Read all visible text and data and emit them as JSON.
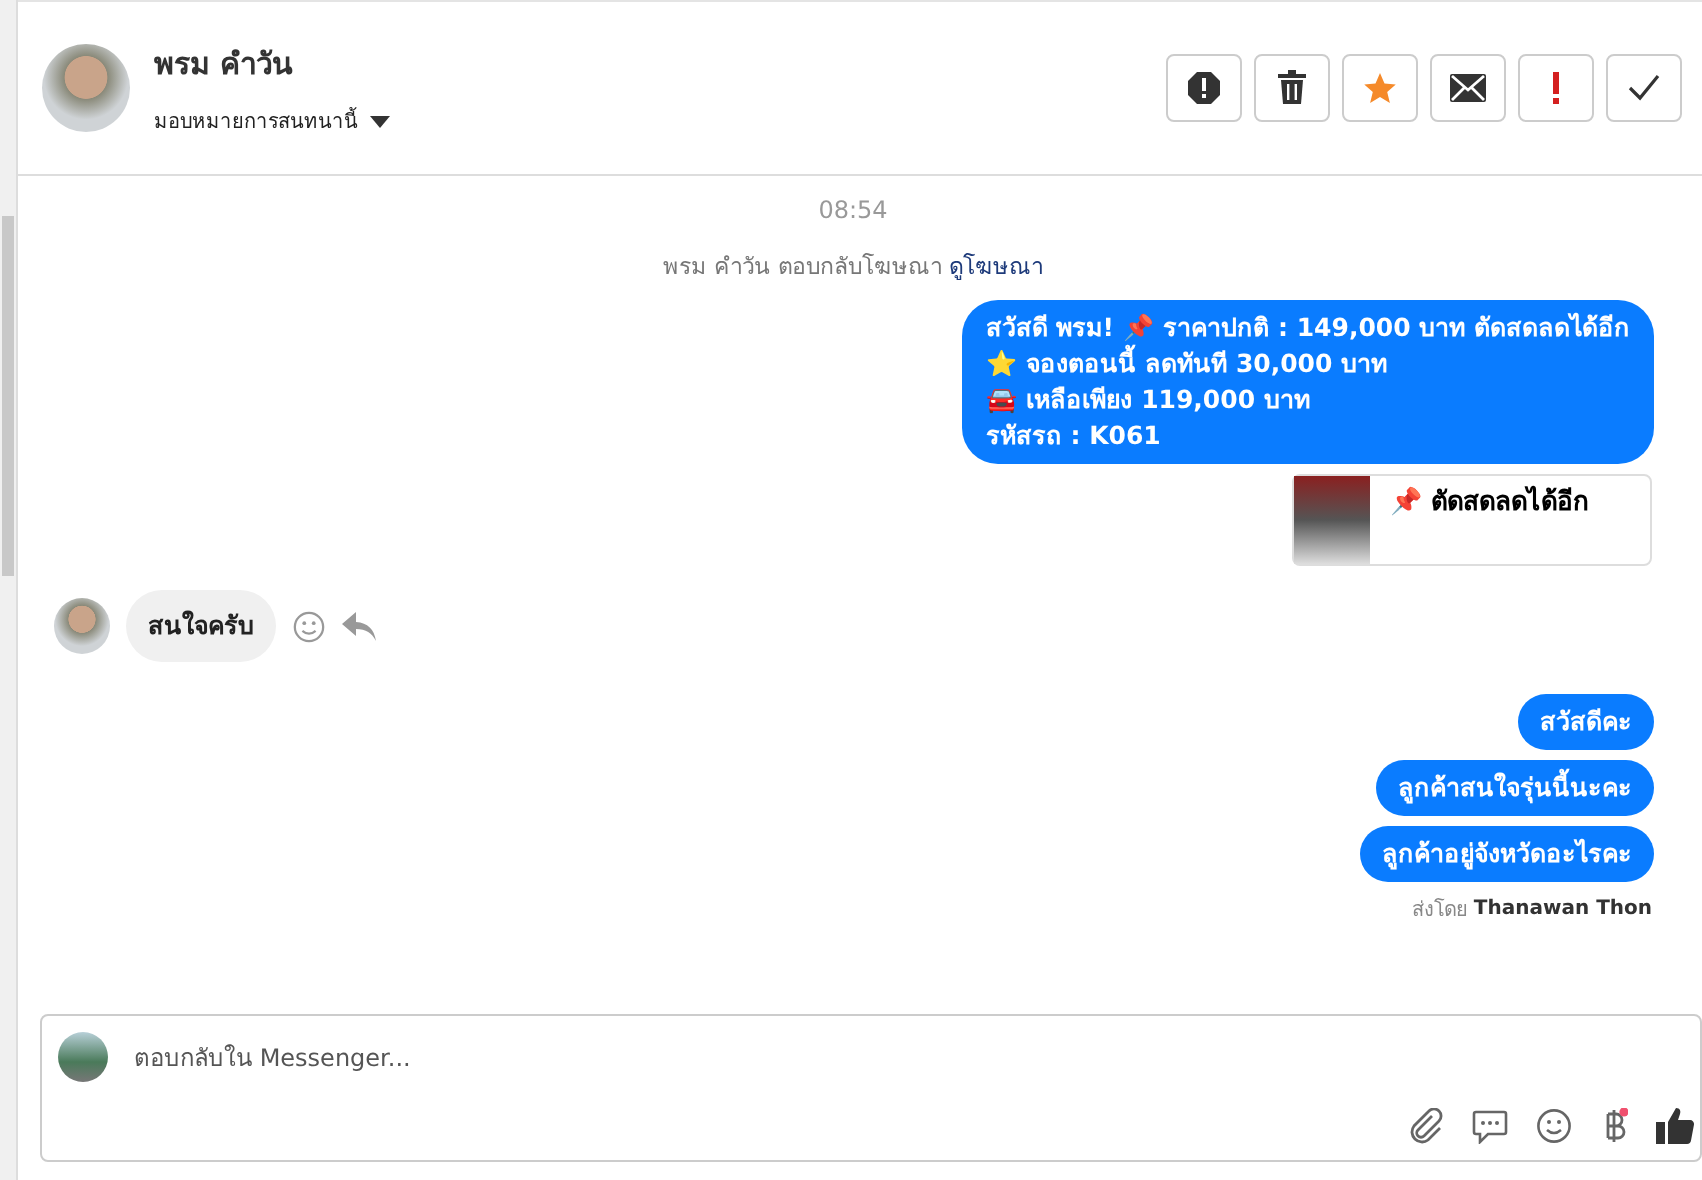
{
  "contact": {
    "name": "พรม คำวัน",
    "subtitle": "มอบหมายการสนทนานี้"
  },
  "messages": [
    {
      "kind": "time",
      "text": "08:54"
    },
    {
      "kind": "notice",
      "text": "พรม คำวัน ตอบกลับโฆษณา",
      "link": "ดูโฆษณา"
    },
    {
      "kind": "outgoing",
      "lines": [
        "สวัสดี พรม! 📌 ราคาปกติ : 149,000 บาท ตัดสดลดได้อีก",
        "⭐ จองตอนนี้ ลดทันที 30,000 บาท",
        "🚘 เหลือเพียง 119,000 บาท",
        "รหัสรถ : K061"
      ]
    },
    {
      "kind": "ad_card",
      "text": "📌 ตัดสดลดได้อีก"
    },
    {
      "kind": "incoming",
      "lines": [
        "สนใจครับ"
      ]
    },
    {
      "kind": "outgoing",
      "lines": [
        "สวัสดีคะ"
      ]
    },
    {
      "kind": "outgoing",
      "lines": [
        "ลูกค้าสนใจรุ่นนี้นะคะ"
      ]
    },
    {
      "kind": "outgoing",
      "lines": [
        "ลูกค้าอยู่จังหวัดอะไรคะ"
      ]
    },
    {
      "kind": "sent_by",
      "label": "ส่งโดย",
      "author": "Thanawan Thon"
    }
  ],
  "composer": {
    "placeholder": "ตอบกลับใน Messenger..."
  }
}
